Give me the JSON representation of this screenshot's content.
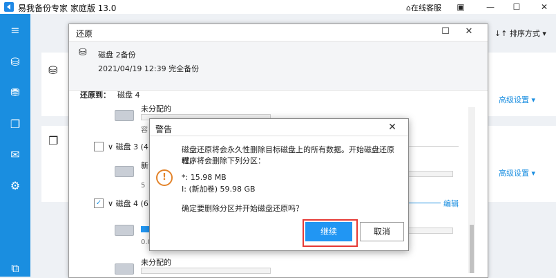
{
  "app": {
    "title": "易我备份专家 家庭版 13.0",
    "online_service": "在线客服"
  },
  "main": {
    "sort_label": "排序方式",
    "advanced_label": "高级设置"
  },
  "restore": {
    "title": "还原",
    "source_name": "磁盘 2备份",
    "source_detail": "2021/04/19 12:39 完全备份",
    "restore_to_label": "还原到：",
    "restore_to_value": "磁盘 4",
    "top_partition_label": "未分配的",
    "disk3_label": "磁盘 3 (4",
    "disk3_part_label": "新",
    "disk3_part_size": "5",
    "disk4_label": "磁盘 4 (6",
    "disk4_part_size": "0.0",
    "edit_label": "编辑",
    "bottom_partition_label": "未分配的",
    "disk3_checked": false,
    "disk4_checked": true
  },
  "warning": {
    "title": "警告",
    "line1": "磁盘还原将会永久性删除目标磁盘上的所有数据。开始磁盘还原时，",
    "line2": "程序将会删除下列分区：",
    "part1": "*: 15.98 MB",
    "part2": "I: (新加卷) 59.98 GB",
    "question": "确定要删除分区并开始磁盘还原吗？",
    "continue_label": "继续",
    "cancel_label": "取消"
  }
}
